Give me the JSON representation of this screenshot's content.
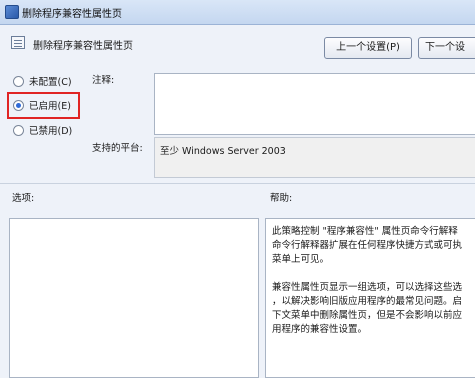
{
  "window": {
    "title": "删除程序兼容性属性页"
  },
  "header": {
    "policy_name": "删除程序兼容性属性页",
    "prev_button": "上一个设置(P)",
    "next_button": "下一个设"
  },
  "radios": {
    "not_configured": "未配置(C)",
    "enabled": "已启用(E)",
    "disabled": "已禁用(D)",
    "selected": "已启用(E)"
  },
  "comment": {
    "label": "注释:",
    "value": ""
  },
  "platform": {
    "label": "支持的平台:",
    "value": "至少 Windows Server 2003"
  },
  "options": {
    "label": "选项:"
  },
  "help": {
    "label": "帮助:",
    "lines": [
      "此策略控制 \"程序兼容性\" 属性页命令行解释",
      "命令行解释器扩展在任何程序快捷方式或可执",
      "菜单上可见。",
      "",
      "兼容性属性页显示一组选项，可以选择这些选",
      "，以解决影响旧版应用程序的最常见问题。启",
      "下文菜单中删除属性页，但是不会影响以前应",
      "用程序的兼容性设置。"
    ]
  },
  "colors": {
    "highlight": "#e02424",
    "radio_selected": "#2f6bd8"
  }
}
